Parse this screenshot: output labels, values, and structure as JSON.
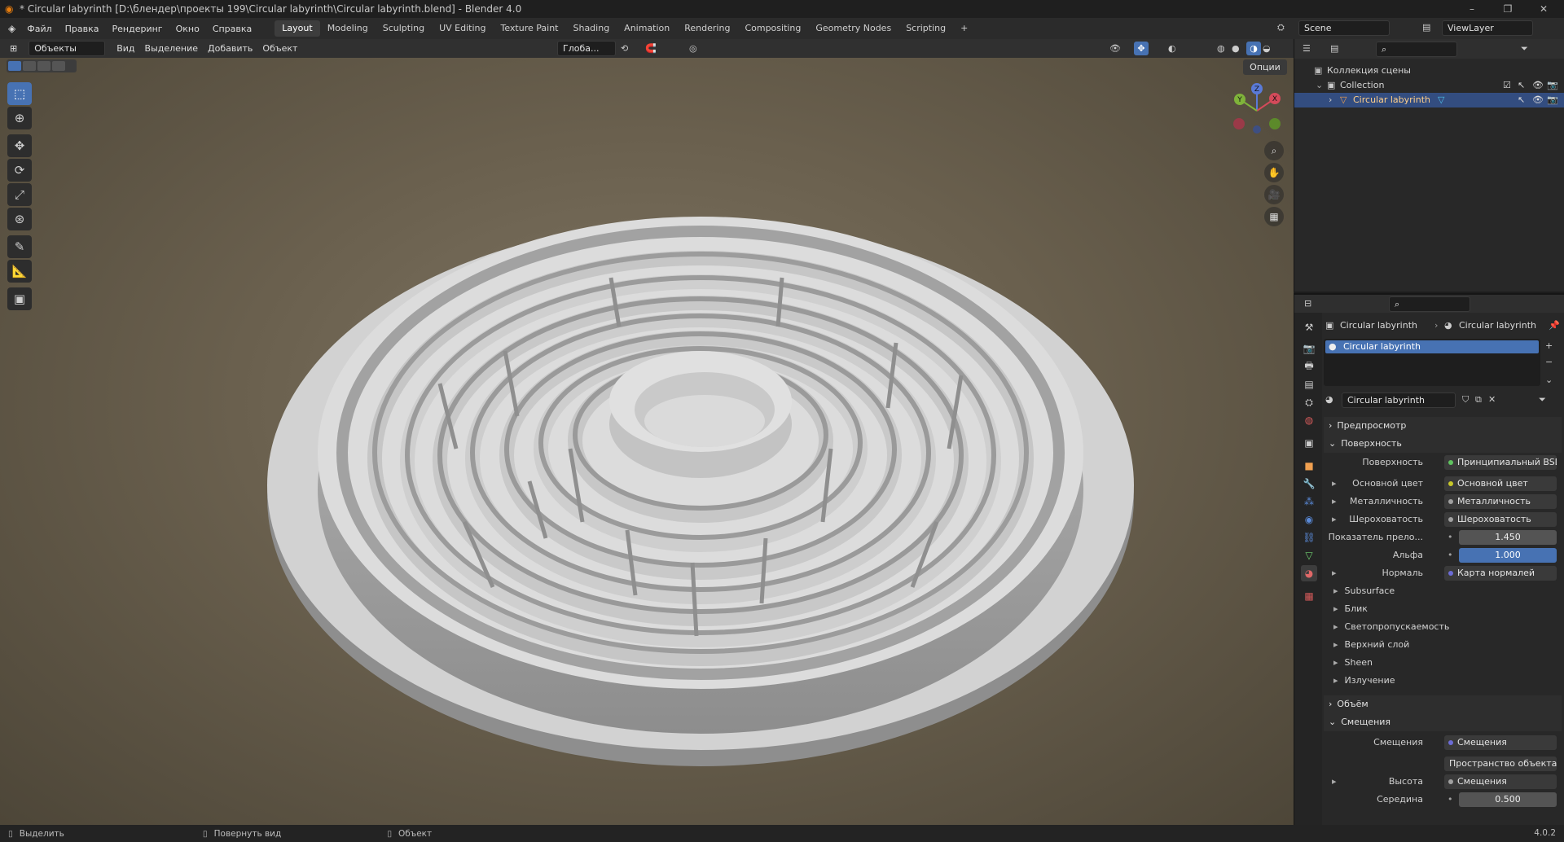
{
  "window": {
    "title": "* Circular labyrinth [D:\\блендер\\проекты 199\\Circular labyrinth\\Circular labyrinth.blend] - Blender 4.0",
    "minimize": "–",
    "maximize": "❐",
    "close": "✕"
  },
  "menu": [
    "Файл",
    "Правка",
    "Рендеринг",
    "Окно",
    "Справка"
  ],
  "workspaces": [
    "Layout",
    "Modeling",
    "Sculpting",
    "UV Editing",
    "Texture Paint",
    "Shading",
    "Animation",
    "Rendering",
    "Compositing",
    "Geometry Nodes",
    "Scripting"
  ],
  "add_workspace": "+",
  "scene": {
    "name": "Scene",
    "view_layer": "ViewLayer"
  },
  "viewport_header": {
    "mode": "Объекты",
    "items": [
      "Вид",
      "Выделение",
      "Добавить",
      "Объект"
    ],
    "orientation": "Глоба...",
    "options": "Опции"
  },
  "gizmo": {
    "x": "X",
    "y": "Y",
    "z": "Z"
  },
  "outliner": {
    "scene_collection": "Коллекция сцены",
    "collection": "Collection",
    "object": "Circular labyrinth"
  },
  "properties": {
    "breadcrumb": [
      "Circular labyrinth",
      "Circular labyrinth"
    ],
    "material_slot": "Circular labyrinth",
    "material_name": "Circular labyrinth",
    "sections": {
      "preview": "Предпросмотр",
      "surface": "Поверхность",
      "volume": "Объём",
      "displacement": "Смещения"
    },
    "surface": {
      "label": "Поверхность",
      "value": "Принципиальный BSDF"
    },
    "base_color": {
      "label": "Основной цвет",
      "value": "Основной цвет"
    },
    "metallic": {
      "label": "Металличность",
      "value": "Металличность"
    },
    "roughness": {
      "label": "Шероховатость",
      "value": "Шероховатость"
    },
    "ior": {
      "label": "Показатель прело...",
      "value": "1.450"
    },
    "alpha": {
      "label": "Альфа",
      "value": "1.000"
    },
    "normal": {
      "label": "Нормаль",
      "value": "Карта нормалей"
    },
    "subpanels": [
      "Subsurface",
      "Блик",
      "Светопропускаемость",
      "Верхний слой",
      "Sheen",
      "Излучение"
    ],
    "disp": {
      "label": "Смещения",
      "value": "Смещения"
    },
    "space": "Пространство объекта",
    "height": {
      "label": "Высота",
      "value": "Смещения"
    },
    "midlevel": {
      "label": "Середина",
      "value": "0.500"
    }
  },
  "status": {
    "select": "Выделить",
    "rotate": "Повернуть вид",
    "object": "Объект",
    "version": "4.0.2"
  }
}
